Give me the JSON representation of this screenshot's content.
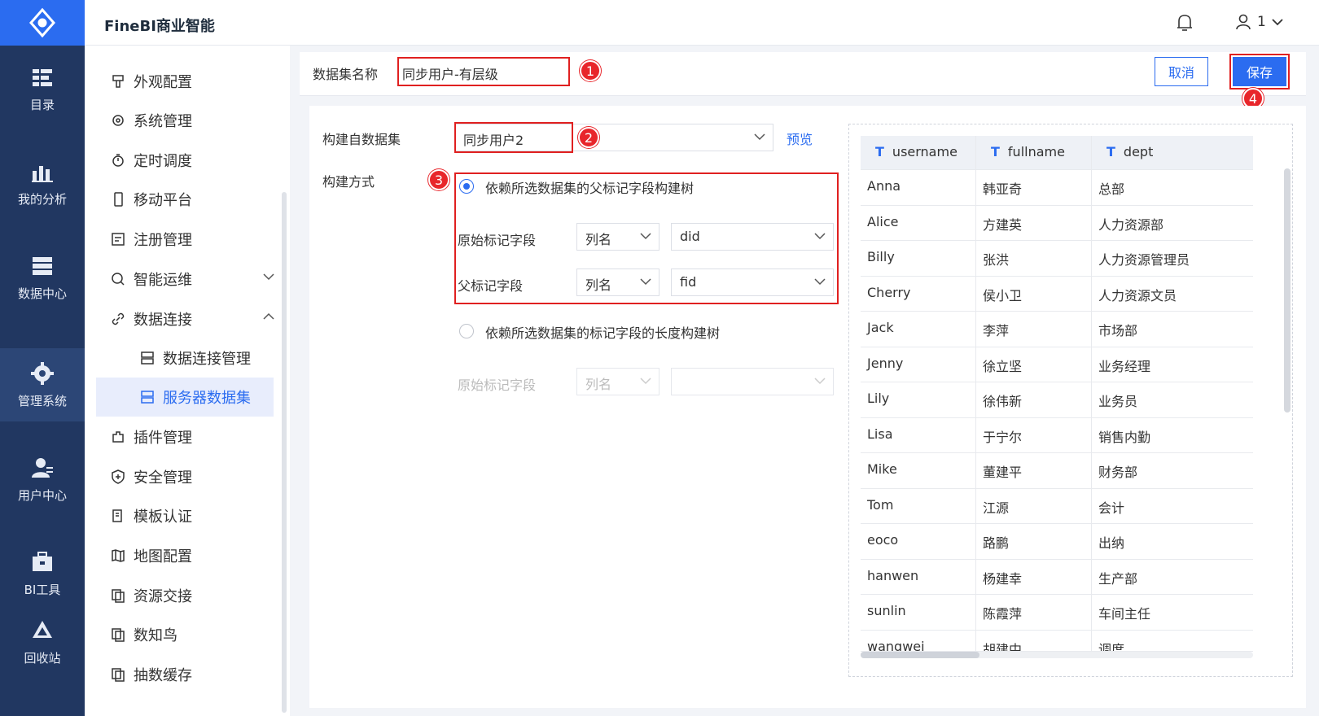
{
  "app": {
    "title": "FineBI商业智能",
    "user": "1"
  },
  "rail": {
    "items": [
      {
        "label": "目录",
        "icon": "catalog-icon"
      },
      {
        "label": "我的分析",
        "icon": "analysis-icon"
      },
      {
        "label": "数据中心",
        "icon": "data-center-icon"
      },
      {
        "label": "管理系统",
        "icon": "gear-icon"
      },
      {
        "label": "用户中心",
        "icon": "user-center-icon"
      },
      {
        "label": "BI工具",
        "icon": "toolbox-icon"
      },
      {
        "label": "回收站",
        "icon": "recycle-icon"
      }
    ]
  },
  "menu": {
    "items": [
      {
        "label": "外观配置"
      },
      {
        "label": "系统管理"
      },
      {
        "label": "定时调度"
      },
      {
        "label": "移动平台"
      },
      {
        "label": "注册管理"
      },
      {
        "label": "智能运维"
      },
      {
        "label": "数据连接"
      },
      {
        "label": "数据连接管理"
      },
      {
        "label": "服务器数据集"
      },
      {
        "label": "插件管理"
      },
      {
        "label": "安全管理"
      },
      {
        "label": "模板认证"
      },
      {
        "label": "地图配置"
      },
      {
        "label": "资源交接"
      },
      {
        "label": "数知鸟"
      },
      {
        "label": "抽数缓存"
      }
    ]
  },
  "header": {
    "dataset_name_label": "数据集名称",
    "dataset_name_value": "同步用户-有层级",
    "cancel": "取消",
    "save": "保存"
  },
  "markers": {
    "m1": "1",
    "m2": "2",
    "m3": "3",
    "m4": "4"
  },
  "form": {
    "source_label": "构建自数据集",
    "source_value": "同步用户2",
    "preview": "预览",
    "method_label": "构建方式",
    "option1": "依赖所选数据集的父标记字段构建树",
    "orig_field_label": "原始标记字段",
    "parent_field_label": "父标记字段",
    "col_type": "列名",
    "orig_field_value": "did",
    "parent_field_value": "fid",
    "option2": "依赖所选数据集的标记字段的长度构建树",
    "orig_field_label2": "原始标记字段",
    "col_type2": "列名"
  },
  "table": {
    "columns": [
      "username",
      "fullname",
      "dept"
    ],
    "rows": [
      [
        "Anna",
        "韩亚奇",
        "总部"
      ],
      [
        "Alice",
        "方建英",
        "人力资源部"
      ],
      [
        "Billy",
        "张洪",
        "人力资源管理员"
      ],
      [
        "Cherry",
        "侯小卫",
        "人力资源文员"
      ],
      [
        "Jack",
        "李萍",
        "市场部"
      ],
      [
        "Jenny",
        "徐立坚",
        "业务经理"
      ],
      [
        "Lily",
        "徐伟新",
        "业务员"
      ],
      [
        "Lisa",
        "于宁尔",
        "销售内勤"
      ],
      [
        "Mike",
        "董建平",
        "财务部"
      ],
      [
        "Tom",
        "江源",
        "会计"
      ],
      [
        "eoco",
        "路鹏",
        "出纳"
      ],
      [
        "hanwen",
        "杨建幸",
        "生产部"
      ],
      [
        "sunlin",
        "陈霞萍",
        "车间主任"
      ],
      [
        "wangwei",
        "胡建中",
        "调度"
      ]
    ]
  }
}
